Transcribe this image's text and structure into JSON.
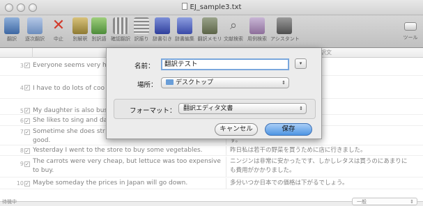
{
  "window": {
    "title": "EJ_sample3.txt"
  },
  "toolbar": {
    "items": [
      {
        "label": "翻訳",
        "icon": "translate-icon"
      },
      {
        "label": "逐次翻訳",
        "icon": "step-translate-icon"
      },
      {
        "label": "中止",
        "icon": "stop-icon"
      },
      {
        "label": "別解釈",
        "icon": "alt-interpretation-icon"
      },
      {
        "label": "別訳語",
        "icon": "alt-word-icon"
      },
      {
        "label": "確認翻訳",
        "icon": "confirm-translate-icon"
      },
      {
        "label": "訳振り",
        "icon": "parallel-display-icon"
      },
      {
        "label": "辞書引き",
        "icon": "dictionary-lookup-icon"
      },
      {
        "label": "辞書編集",
        "icon": "dictionary-edit-icon"
      },
      {
        "label": "翻訳メモリ",
        "icon": "translation-memory-icon"
      },
      {
        "label": "文献検索",
        "icon": "reference-search-icon"
      },
      {
        "label": "用例検索",
        "icon": "example-search-icon"
      },
      {
        "label": "アシスタント",
        "icon": "assistant-icon"
      },
      {
        "label": "ツール",
        "icon": "tools-icon"
      }
    ]
  },
  "table": {
    "columns": [
      "",
      "原文",
      "訳文"
    ],
    "rows": [
      {
        "num": "3",
        "checked": "✓",
        "src": "Everyone seems very h",
        "dst": "うれしそうに思われます、しかし"
      },
      {
        "num": "4",
        "checked": "✓",
        "src": "I have to do lots of coo",
        "dst": "いるたくさんの料理をしなければ"
      },
      {
        "num": "5",
        "checked": "✓",
        "src": "My daughter is also bus",
        "dst": ""
      },
      {
        "num": "6",
        "checked": "✓",
        "src": "She likes to sing and da",
        "dst": "好みます。"
      },
      {
        "num": "7",
        "checked": "✓",
        "src": "Sometime she does str",
        "src2": "good.",
        "dst": "、しかし通常彼女は非常に良いで",
        "dst2": "す。"
      },
      {
        "num": "8",
        "checked": "✓",
        "src": "Yesterday I went to the store to buy some vegetables.",
        "dst": "昨日私は若干の野菜を買うために店に行きました。"
      },
      {
        "num": "9",
        "checked": "✓",
        "src": "The carrots were very cheap, but lettuce was too expensive",
        "src2": "to buy.",
        "dst": "ニンジンは非常に安かったです、しかしレタスは買うのにあまりに",
        "dst2": "も費用がかかりました。"
      },
      {
        "num": "10",
        "checked": "✓",
        "src": "Maybe someday the prices in Japan will go down.",
        "dst": "多分いつか日本での価格は下がるでしょう。"
      }
    ]
  },
  "status": {
    "text": "待機中",
    "mode": "一般"
  },
  "dialog": {
    "name_label": "名前：",
    "name_value": "翻訳テスト",
    "where_label": "場所：",
    "where_value": "デスクトップ",
    "format_label": "フォーマット：",
    "format_value": "翻訳エディタ文書",
    "cancel_label": "キャンセル",
    "save_label": "保存"
  },
  "colors": {
    "accent": "#4e95e3",
    "field_focus": "#7aa7dd"
  }
}
